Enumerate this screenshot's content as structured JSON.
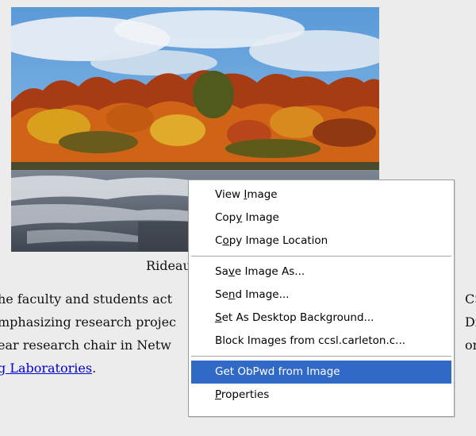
{
  "page": {
    "caption": "Rideau River w",
    "body_lines": [
      {
        "left": "he faculty and students act",
        "right": "CS"
      },
      {
        "left": "mphasizing research projec",
        "right": "Dir"
      },
      {
        "left": "ear research chair in Netw",
        "right": "orr"
      },
      {
        "left": "g Laboratories",
        "right": ""
      }
    ],
    "link_suffix": ".",
    "photo": {
      "description": "autumn river landscape",
      "colors": {
        "sky": "#6aa6dd",
        "cloud": "#e9eef3",
        "foliage_red": "#b03a12",
        "foliage_orange": "#d86d14",
        "foliage_yellow": "#d9a21c",
        "foliage_green": "#5d6a1a",
        "water": "#5d6a78",
        "rapids": "#d9dde2"
      }
    }
  },
  "context_menu": {
    "groups": [
      [
        {
          "pre": "View ",
          "acc": "I",
          "post": "mage",
          "id": "view-image"
        },
        {
          "pre": "Cop",
          "acc": "y",
          "post": " Image",
          "id": "copy-image"
        },
        {
          "pre": "C",
          "acc": "o",
          "post": "py Image Location",
          "id": "copy-image-location"
        }
      ],
      [
        {
          "pre": "Sa",
          "acc": "v",
          "post": "e Image As...",
          "id": "save-image-as"
        },
        {
          "pre": "Se",
          "acc": "n",
          "post": "d Image...",
          "id": "send-image"
        },
        {
          "pre": "",
          "acc": "S",
          "post": "et As Desktop Background...",
          "id": "set-desktop-background"
        },
        {
          "pre": "Block Ima",
          "acc": "g",
          "post": "es from ccsl.carleton.c...",
          "id": "block-images"
        }
      ],
      [
        {
          "pre": "Get ObPwd from Image",
          "acc": "",
          "post": "",
          "id": "get-obpwd",
          "highlighted": true
        },
        {
          "pre": "",
          "acc": "P",
          "post": "roperties",
          "id": "properties"
        }
      ]
    ],
    "highlight_color": "#3169c6"
  }
}
